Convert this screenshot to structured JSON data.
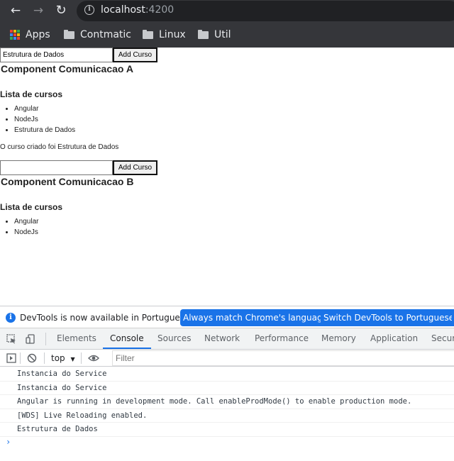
{
  "browser": {
    "url_host": "localhost",
    "url_port": ":4200",
    "back": "←",
    "forward": "→",
    "reload": "↻",
    "info": "i",
    "bookmarks": [
      {
        "label": "Apps",
        "icon": "apps-grid-icon"
      },
      {
        "label": "Contmatic",
        "icon": "folder-icon"
      },
      {
        "label": "Linux",
        "icon": "folder-icon"
      },
      {
        "label": "Util",
        "icon": "folder-icon"
      }
    ]
  },
  "page": {
    "component_a": {
      "input_value": "Estrutura de Dados",
      "button_label": "Add Curso",
      "title": "Component Comunicacao A",
      "list_title": "Lista de cursos",
      "courses": [
        "Angular",
        "NodeJs",
        "Estrutura de Dados"
      ],
      "created_message": "O curso criado foi Estrutura de Dados"
    },
    "component_b": {
      "input_value": "",
      "button_label": "Add Curso",
      "title": "Component Comunicacao B",
      "list_title": "Lista de cursos",
      "courses": [
        "Angular",
        "NodeJs"
      ]
    }
  },
  "devtools": {
    "info_text": "DevTools is now available in Portuguese!",
    "info_icon": "i",
    "btn_match": "Always match Chrome's language",
    "btn_switch": "Switch DevTools to Portuguese",
    "tabs": [
      "Elements",
      "Console",
      "Sources",
      "Network",
      "Performance",
      "Memory",
      "Application",
      "Securi"
    ],
    "active_tab": "Console",
    "context": "top",
    "context_arrow": "▼",
    "filter_placeholder": "Filter",
    "log": [
      "Instancia do Service",
      "Instancia do Service",
      "Angular is running in development mode. Call enableProdMode() to enable production mode.",
      "[WDS] Live Reloading enabled.",
      "Estrutura de Dados"
    ],
    "prompt": "›"
  }
}
